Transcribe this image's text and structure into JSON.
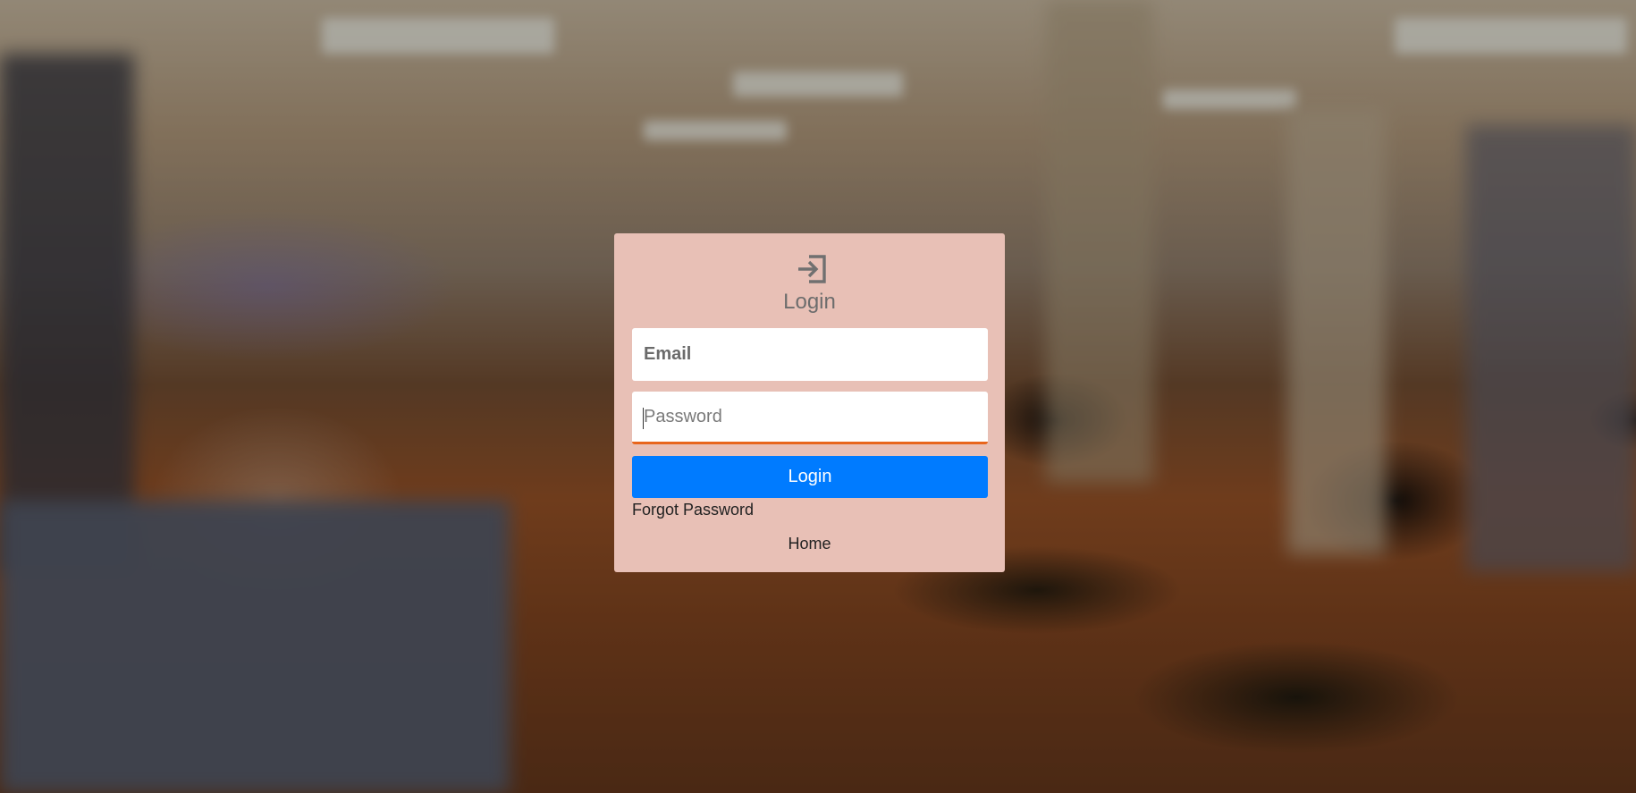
{
  "login_card": {
    "icon": "login-arrow-icon",
    "title": "Login",
    "email_placeholder": "Email",
    "email_value": "",
    "password_placeholder": "Password",
    "password_value": "",
    "login_button_label": "Login",
    "forgot_password_label": "Forgot Password",
    "home_label": "Home"
  },
  "colors": {
    "card_background": "#e8c0b6",
    "primary_button": "#007bff",
    "focus_underline": "#e8651c",
    "title_text": "#6d6d6d"
  }
}
